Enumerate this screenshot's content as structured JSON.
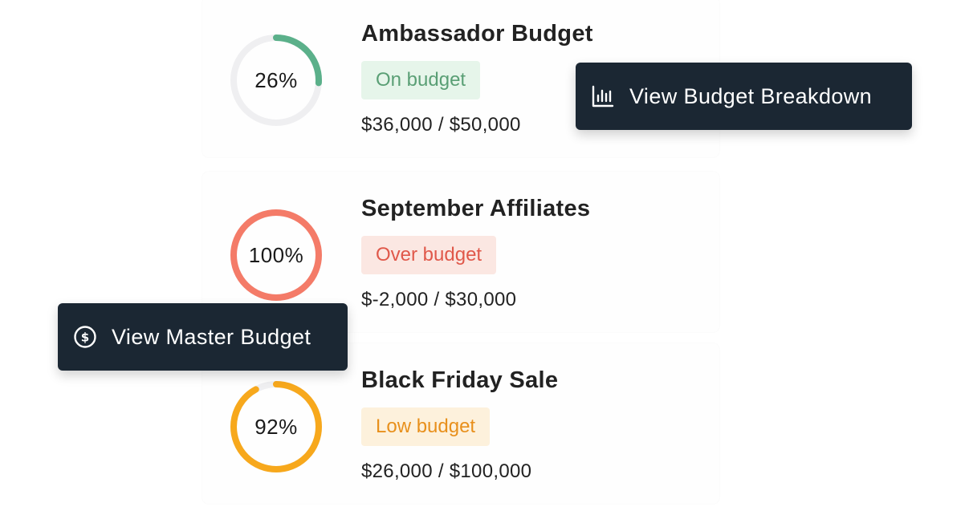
{
  "budgets": [
    {
      "title": "Ambassador Budget",
      "percent_label": "26%",
      "progress": 0.26,
      "ring_color": "#5bb08a",
      "status": "On budget",
      "badge_bg": "#e6f5ea",
      "badge_fg": "#5a9f75",
      "amount": "$36,000 / $50,000"
    },
    {
      "title": "September Affiliates",
      "percent_label": "100%",
      "progress": 1.0,
      "ring_color": "#f47b68",
      "status": "Over budget",
      "badge_bg": "#fbe7e2",
      "badge_fg": "#e0584a",
      "amount": "$-2,000 / $30,000"
    },
    {
      "title": "Black Friday Sale",
      "percent_label": "92%",
      "progress": 0.92,
      "ring_color": "#f7a81c",
      "status": "Low budget",
      "badge_bg": "#fdf1dc",
      "badge_fg": "#e8901c",
      "amount": "$26,000 / $100,000"
    }
  ],
  "ring_track_color": "#efeff1",
  "actions": {
    "breakdown": {
      "label": "View Budget Breakdown",
      "icon": "bar-chart-icon"
    },
    "master": {
      "label": "View Master Budget",
      "icon": "dollar-circle-icon"
    }
  }
}
